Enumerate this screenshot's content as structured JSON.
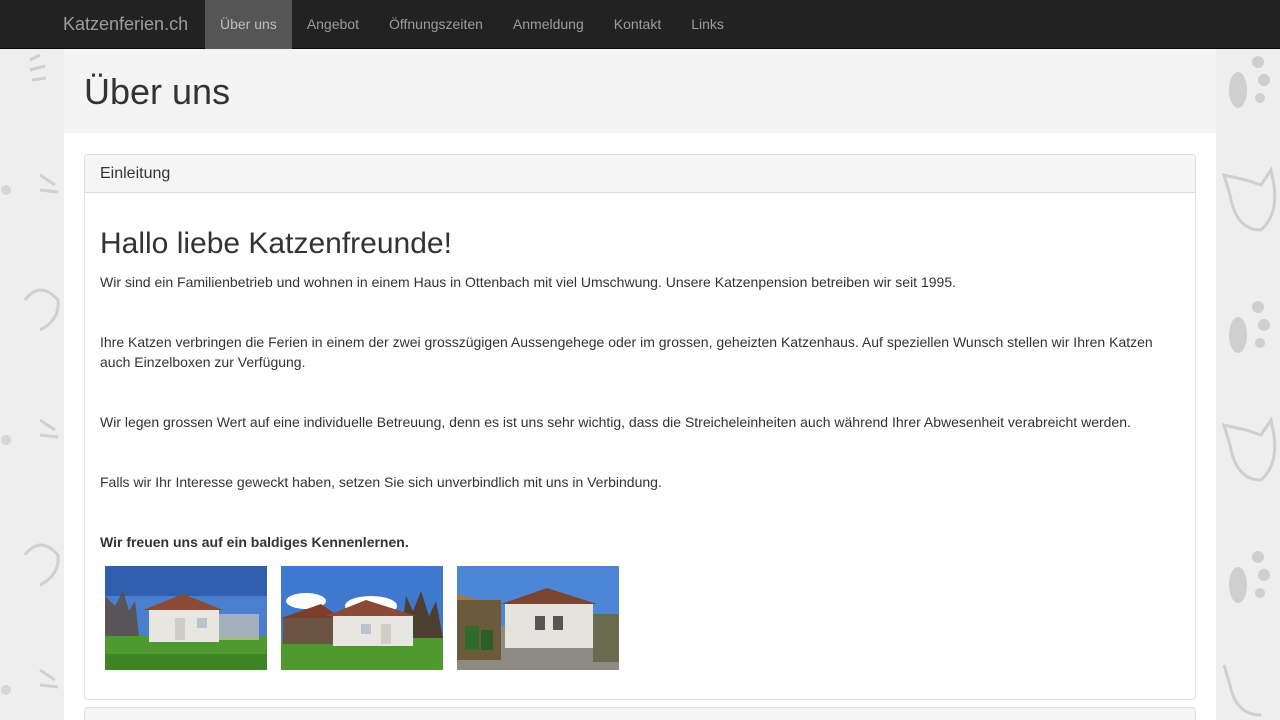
{
  "navbar": {
    "brand": "Katzenferien.ch",
    "items": [
      {
        "label": "Über uns",
        "active": true
      },
      {
        "label": "Angebot",
        "active": false
      },
      {
        "label": "Öffnungszeiten",
        "active": false
      },
      {
        "label": "Anmeldung",
        "active": false
      },
      {
        "label": "Kontakt",
        "active": false
      },
      {
        "label": "Links",
        "active": false
      }
    ]
  },
  "page": {
    "title": "Über uns"
  },
  "panel": {
    "heading": "Einleitung",
    "greeting": "Hallo liebe Katzenfreunde!",
    "paragraphs": [
      "Wir sind ein Familienbetrieb und wohnen in einem Haus in Ottenbach mit viel Umschwung. Unsere Katzenpension betreiben wir seit 1995.",
      "Ihre Katzen verbringen die Ferien in einem der zwei grosszügigen Aussengehege oder im grossen, geheizten Katzenhaus. Auf speziellen Wunsch stellen wir Ihren Katzen auch Einzelboxen zur Verfügung.",
      "Wir legen grossen Wert auf eine individuelle Betreuung, denn es ist uns sehr wichtig, dass die Streicheleinheiten auch während Ihrer Abwesenheit verabreicht werden.",
      "Falls wir Ihr Interesse geweckt haben, setzen Sie sich unverbindlich mit uns in Verbindung."
    ],
    "closing": "Wir freuen uns auf ein baldiges Kennenlernen."
  },
  "gallery": {
    "images": [
      {
        "name": "cat-house-photo-1"
      },
      {
        "name": "cat-house-photo-2"
      },
      {
        "name": "cat-house-photo-3"
      }
    ]
  },
  "colors": {
    "navbar_bg": "#222222",
    "nav_active_bg": "#555555",
    "nav_text": "#9d9d9d",
    "jumbotron_bg": "#f4f4f4",
    "panel_heading_bg": "#f5f5f5",
    "page_bg": "#eeeeee"
  }
}
